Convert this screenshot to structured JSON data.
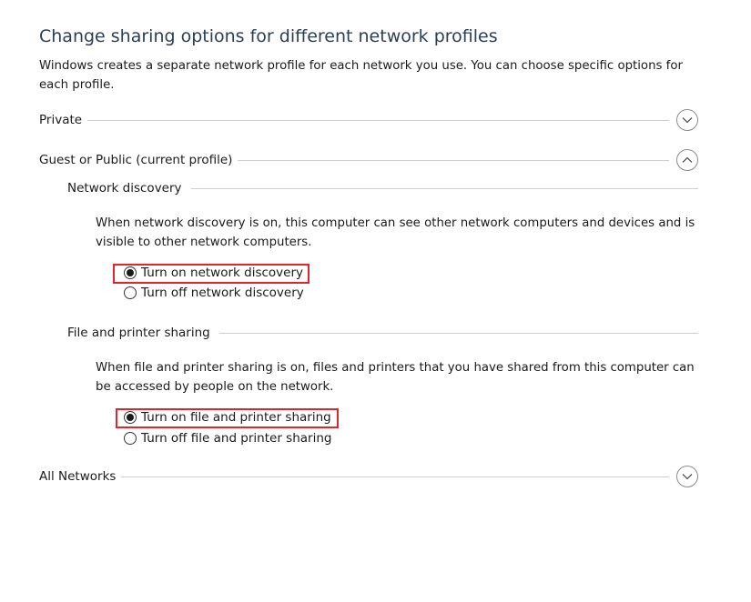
{
  "page": {
    "title": "Change sharing options for different network profiles",
    "description": "Windows creates a separate network profile for each network you use. You can choose specific options for each profile."
  },
  "profiles": {
    "private": {
      "label": "Private",
      "expanded": false
    },
    "guest_public": {
      "label": "Guest or Public (current profile)",
      "expanded": true
    },
    "all_networks": {
      "label": "All Networks",
      "expanded": false
    }
  },
  "network_discovery": {
    "heading": "Network discovery",
    "description": "When network discovery is on, this computer can see other network computers and devices and is visible to other network computers.",
    "options": [
      {
        "label": "Turn on network discovery",
        "selected": true,
        "highlighted": true
      },
      {
        "label": "Turn off network discovery",
        "selected": false,
        "highlighted": false
      }
    ]
  },
  "file_printer_sharing": {
    "heading": "File and printer sharing",
    "description": "When file and printer sharing is on, files and printers that you have shared from this computer can be accessed by people on the network.",
    "options": [
      {
        "label": "Turn on file and printer sharing",
        "selected": true,
        "highlighted": true
      },
      {
        "label": "Turn off file and printer sharing",
        "selected": false,
        "highlighted": false
      }
    ]
  },
  "colors": {
    "title": "#2b3f57",
    "highlight_border": "#e0262b",
    "divider": "#cfcfcf"
  },
  "icons": {
    "collapsed": "chevron-down-icon",
    "expanded": "chevron-up-icon"
  }
}
